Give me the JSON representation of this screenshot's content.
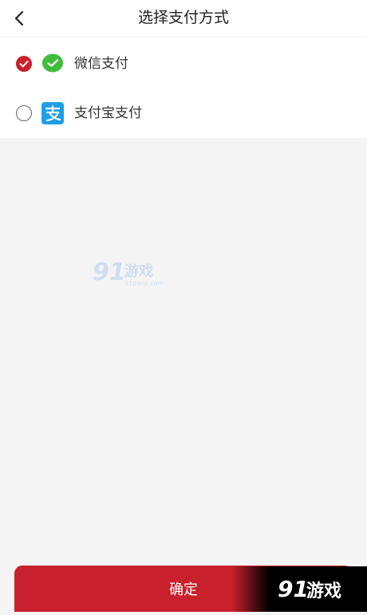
{
  "header": {
    "title": "选择支付方式",
    "back_icon": "chevron-left-icon"
  },
  "payment_methods": [
    {
      "label": "微信支付",
      "icon": "wechat-icon",
      "selected": true,
      "color": "#3fbd3a"
    },
    {
      "label": "支付宝支付",
      "icon": "alipay-icon",
      "selected": false,
      "color": "#1d9fe8"
    }
  ],
  "footer": {
    "confirm_label": "确定"
  },
  "colors": {
    "accent": "#c8202c",
    "background": "#f4f4f4"
  },
  "watermark": {
    "brand": "91游戏",
    "domain": "91danji.com"
  }
}
